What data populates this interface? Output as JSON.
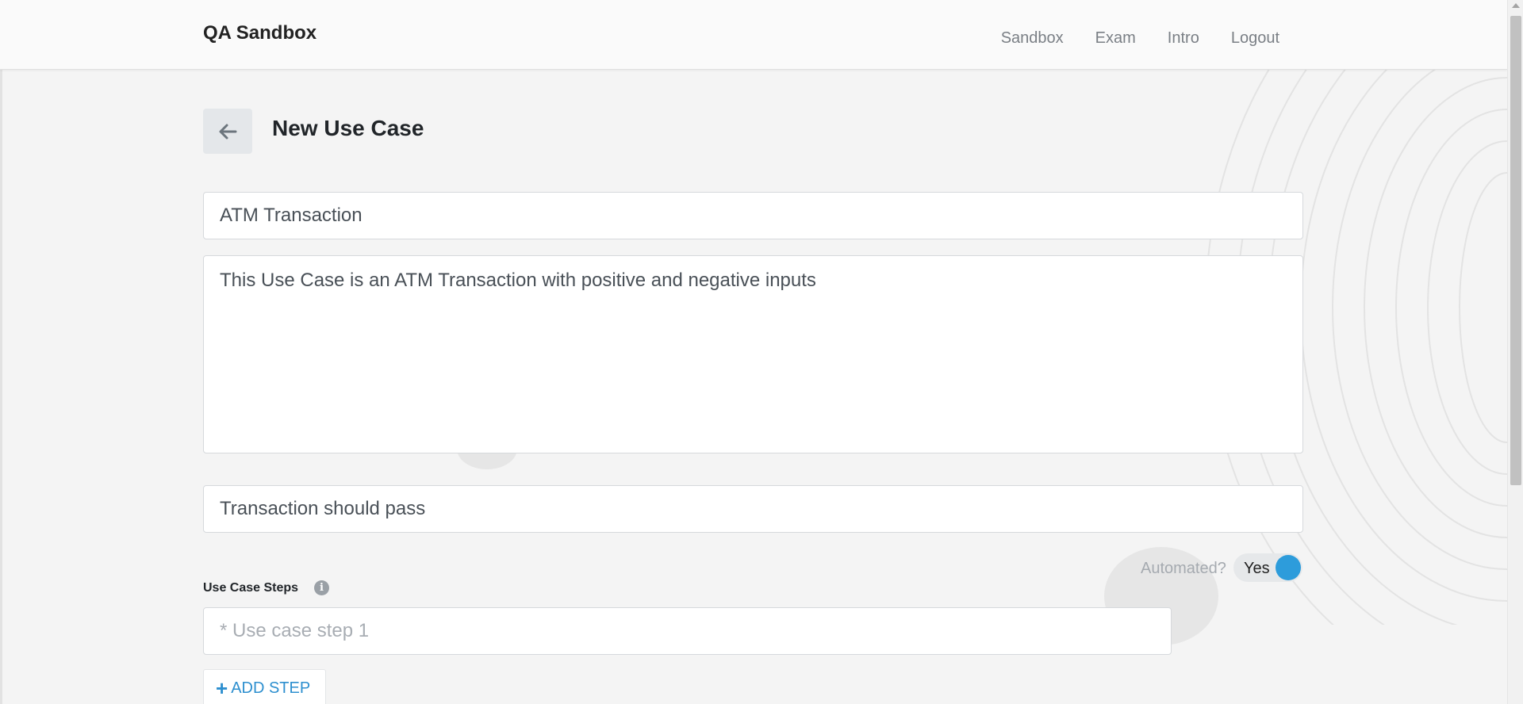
{
  "header": {
    "brand": "QA Sandbox",
    "nav": [
      "Sandbox",
      "Exam",
      "Intro",
      "Logout"
    ]
  },
  "page": {
    "title": "New Use Case",
    "back_icon": "arrow-left-icon"
  },
  "form": {
    "title_value": "ATM Transaction",
    "description_value": "This Use Case is an ATM Transaction with positive and negative inputs",
    "expected_result_value": "Transaction should pass",
    "automated_label": "Automated?",
    "automated_toggle_text": "Yes",
    "automated_on": true,
    "steps_label": "Use Case Steps",
    "info_icon": "info-icon",
    "step_placeholder": "* Use case step 1",
    "add_step_label": "ADD STEP"
  },
  "colors": {
    "accent": "#2d9cdb",
    "background": "#f4f4f4"
  }
}
